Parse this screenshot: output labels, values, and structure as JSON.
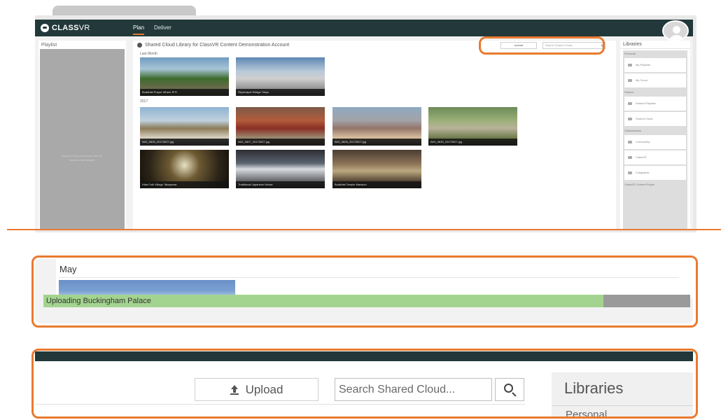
{
  "app": {
    "brand_class": "CLASS",
    "brand_vr": "VR",
    "nav": [
      "Plan",
      "Deliver"
    ]
  },
  "playlist": {
    "title": "Playlist",
    "hint": "Drag and drop resources here to create a new playlist"
  },
  "main": {
    "title": "Shared Cloud Library for ClassVR Content Demonstration Account",
    "upload_label": "Upload",
    "search_placeholder": "Search Shared Cloud...",
    "sections": [
      "Last Month",
      "2017"
    ],
    "items": [
      "Buddhist Prayer Wheel JPG",
      "Skyscraper Bridge Tokyo",
      "IMG_0826_20170527.jpg",
      "IMG_0827_20170527.jpg",
      "IMG_0828_20170527.jpg",
      "IMG_0830_20170527.jpg",
      "Hida Folk Village Takayama",
      "Traditional Japanese House",
      "Buddhist Temple Mansion"
    ]
  },
  "libraries": {
    "title": "Libraries",
    "personal": "Personal",
    "personal_items": [
      "My Playlists",
      "My Cloud"
    ],
    "shared": "Shared",
    "shared_items": [
      "Shared Playlists",
      "Shared Cloud"
    ],
    "subscriptions": "Subscriptions",
    "subscription_items": [
      "Community",
      "ClassVR",
      "Collapsible"
    ],
    "footer": "ClassVR Content Player"
  },
  "zoom_upload": {
    "month": "May",
    "progress_label": "Uploading Buckingham Palace",
    "progress_fraction": 0.866
  },
  "zoom_toolbar": {
    "upload_label": "Upload",
    "search_placeholder": "Search Shared Cloud...",
    "libraries_title": "Libraries",
    "personal_label": "Personal"
  },
  "colors": {
    "topbar": "#22383b",
    "callout": "#ea7a2f",
    "progress_fill": "#a3d48f",
    "progress_track": "#9a9a9a"
  }
}
